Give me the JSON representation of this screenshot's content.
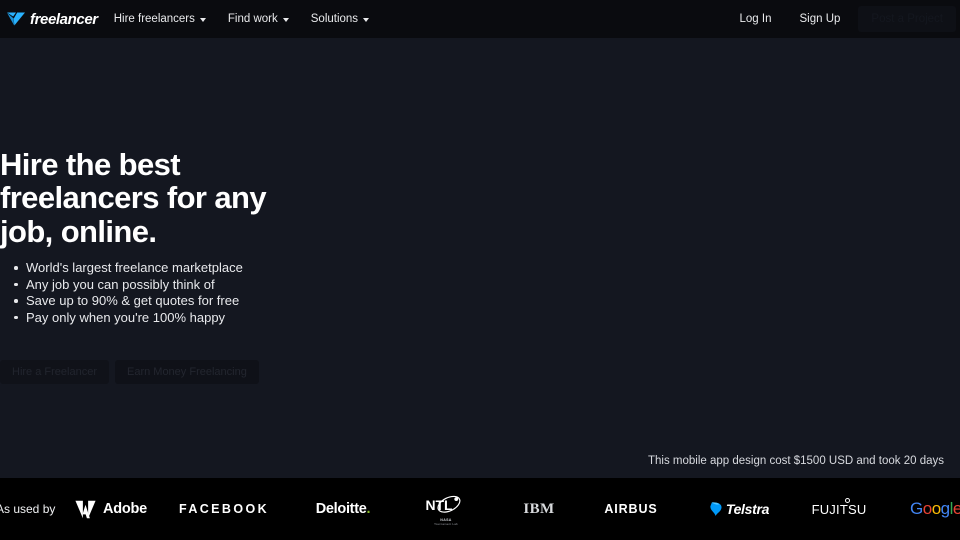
{
  "nav": {
    "logo_text": "freelancer",
    "logo_icon": "freelancer-bird-icon",
    "links": [
      {
        "label": "Hire freelancers",
        "icon": "chevron-down-icon"
      },
      {
        "label": "Find work",
        "icon": "chevron-down-icon"
      },
      {
        "label": "Solutions",
        "icon": "chevron-down-icon"
      }
    ],
    "login_label": "Log In",
    "signup_label": "Sign Up",
    "post_project_label": "Post a Project"
  },
  "hero": {
    "headline": "Hire the best freelancers for any job, online.",
    "bullets": [
      "World's largest freelance marketplace",
      "Any job you can possibly think of",
      "Save up to 90% & get quotes for free",
      "Pay only when you're 100% happy"
    ],
    "cta_primary": "Hire a Freelancer",
    "cta_secondary": "Earn Money Freelancing",
    "caption": "This mobile app design cost $1500 USD and took 20 days"
  },
  "logobar": {
    "intro": "As used by",
    "brands": [
      {
        "name": "Adobe",
        "label": "Adobe",
        "icon": "adobe-logo-icon"
      },
      {
        "name": "Facebook",
        "label": "FACEBOOK",
        "icon": "facebook-wordmark-icon"
      },
      {
        "name": "Deloitte",
        "label": "Deloitte",
        "suffix": ".",
        "icon": "deloitte-logo-icon"
      },
      {
        "name": "NASA",
        "label": "NTL",
        "sub1": "NASA",
        "sub2": "Tournament Lab",
        "icon": "nasa-ntl-logo-icon"
      },
      {
        "name": "IBM",
        "label": "IBM",
        "icon": "ibm-wordmark-icon"
      },
      {
        "name": "Airbus",
        "label": "AIRBUS",
        "icon": "airbus-wordmark-icon"
      },
      {
        "name": "Telstra",
        "label": "Telstra",
        "icon": "telstra-logo-icon"
      },
      {
        "name": "Fujitsu",
        "label": "FUJITSU",
        "icon": "fujitsu-wordmark-icon"
      },
      {
        "name": "Google",
        "label": "Google",
        "icon": "google-wordmark-icon"
      }
    ]
  },
  "colors": {
    "nav_bg": "#0a0b0f",
    "hero_bg": "#141720",
    "logobar_bg": "#000000",
    "brand_blue": "#29b2fe",
    "text_primary": "#ffffff",
    "deloitte_green": "#86bc25",
    "google_blue": "#4285f4",
    "google_red": "#ea4335",
    "google_yellow": "#fbbc05",
    "google_green": "#34a853"
  }
}
